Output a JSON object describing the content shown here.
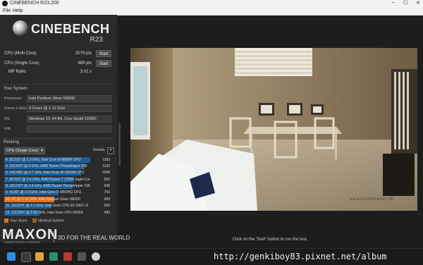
{
  "window": {
    "title": "CINEBENCH R23.200",
    "minimize": "–",
    "maximize": "☐",
    "close": "✕"
  },
  "menu": {
    "file": "File",
    "help": "Help"
  },
  "logo": {
    "name": "CINEBENCH",
    "version": "R23"
  },
  "scores": {
    "multi": {
      "label": "CPU (Multi Core)",
      "value": "2079 pts",
      "button": "Start"
    },
    "single": {
      "label": "CPU (Single Core)",
      "value": "689 pts",
      "button": "Start"
    },
    "mp": {
      "label": "MP Ratio",
      "value": "3.02 x"
    }
  },
  "system": {
    "heading": "Your System",
    "rows": [
      {
        "key": "Processor",
        "value": "Intel Pentium Silver N6000"
      },
      {
        "key": "Cores x GHz",
        "value": "4 Cores @ 1.12 GHz"
      },
      {
        "key": "OS",
        "value": "Windows 10, 64 Bit, Core (build 22000)"
      },
      {
        "key": "Info",
        "value": ""
      }
    ]
  },
  "ranking": {
    "heading": "Ranking",
    "mode": "CPU (Single Core)",
    "details_label": "Details",
    "max_score": 1183,
    "rows": [
      {
        "text": "4. 8C/16T @ 2.3 GHz, Intel Core i9-9880H CPU",
        "score": "1183",
        "value": 1183,
        "highlight": false
      },
      {
        "text": "5. 32C/64T @ 3 GHz, AMD Ryzen Threadripper 299",
        "score": "1109",
        "value": 1109,
        "highlight": false
      },
      {
        "text": "6. 24C/48T @ 2.7 GHz, Intel Xeon W-3265M CPU",
        "score": "1058",
        "value": 1058,
        "highlight": false
      },
      {
        "text": "7. 8C/16T @ 3.4 GHz, AMD Ryzen 7 1700X Eight-Cor",
        "score": "959",
        "value": 959,
        "highlight": false
      },
      {
        "text": "8. 16C/32T @ 3.4 GHz, AMD Ryzen Threadripper 195",
        "score": "945",
        "value": 945,
        "highlight": false
      },
      {
        "text": "9. 4C/8T @ 2.3 GHz, Intel Core i7-4850HQ CPU",
        "score": "750",
        "value": 750,
        "highlight": false
      },
      {
        "text": "10. 4C @ 1.12 GHz, Intel Pentium Silver N6000",
        "score": "689",
        "value": 689,
        "highlight": true
      },
      {
        "text": "11. 12C/24T @ 2.7 GHz, Intel Xeon CPU E5-2697 v2",
        "score": "653",
        "value": 653,
        "highlight": false
      },
      {
        "text": "12. 12C/24T @ 2.66 GHz, Intel Xeon CPU X5650",
        "score": "486",
        "value": 486,
        "highlight": false
      }
    ]
  },
  "legend": {
    "your_score": "Your Score",
    "identical": "Identical System"
  },
  "colors": {
    "bar": "#1e5f99",
    "your_score": "#e07020",
    "identical": "#a05a20"
  },
  "render": {
    "watermark": "www.renderbaron.de"
  },
  "status": "Click on the 'Start' button to run the test.",
  "branding": {
    "maxon": "MAXON",
    "maxon_sub": "A NEMETSCHEK COMPANY",
    "tagline": "3D FOR THE REAL WORLD"
  },
  "footer_watermark": "http://genkiboy83.pixnet.net/album",
  "taskbar_icons": [
    "windows-icon",
    "search-icon",
    "task-view-icon",
    "explorer-icon",
    "edge-icon",
    "store-icon",
    "cinebench-icon"
  ]
}
